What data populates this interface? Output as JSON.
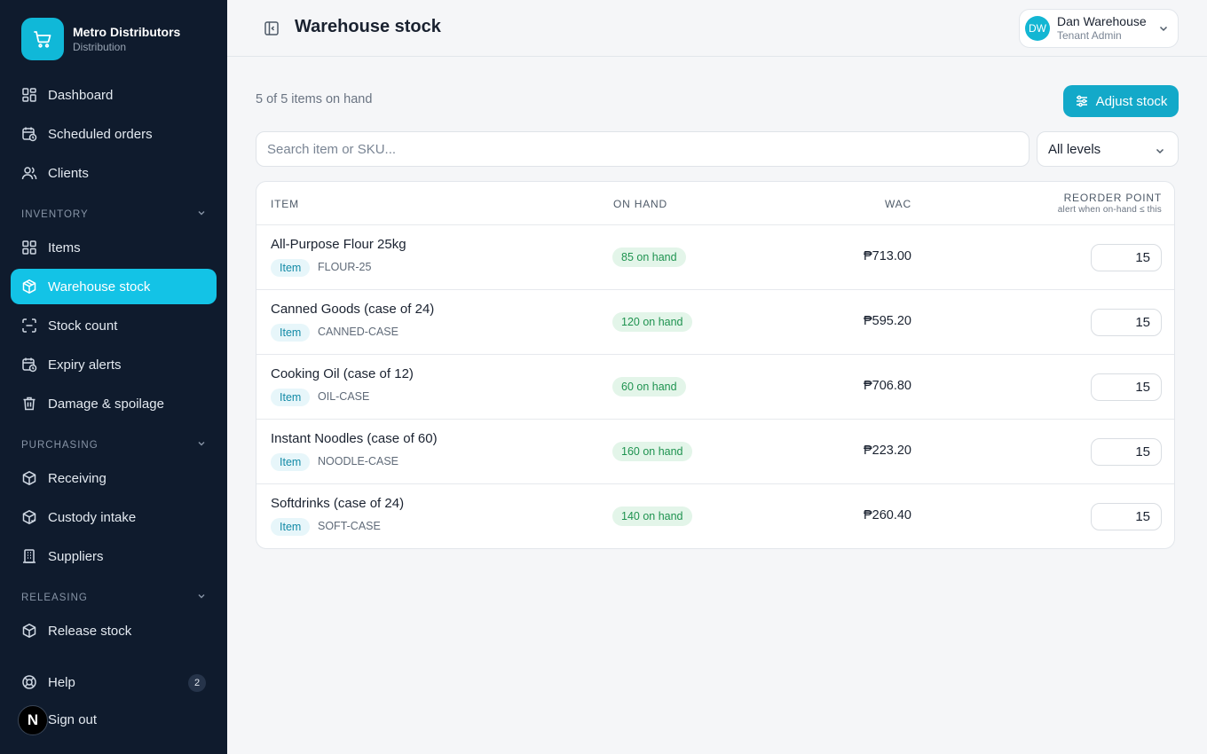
{
  "brand": {
    "name": "Metro Distributors",
    "subtitle": "Distribution",
    "logo_icon": "cart-icon",
    "color": "#10b8d8"
  },
  "sidebar": {
    "top_items": [
      {
        "label": "Dashboard",
        "icon": "dashboard-icon"
      },
      {
        "label": "Scheduled orders",
        "icon": "calendar-clock-icon"
      },
      {
        "label": "Clients",
        "icon": "users-icon"
      }
    ],
    "sections": [
      {
        "label": "INVENTORY",
        "items": [
          {
            "label": "Items",
            "icon": "grid-icon"
          },
          {
            "label": "Warehouse stock",
            "icon": "box-icon",
            "active": true
          },
          {
            "label": "Stock count",
            "icon": "scan-icon"
          },
          {
            "label": "Expiry alerts",
            "icon": "calendar-clock-icon"
          },
          {
            "label": "Damage & spoilage",
            "icon": "trash-icon"
          }
        ]
      },
      {
        "label": "PURCHASING",
        "items": [
          {
            "label": "Receiving",
            "icon": "box-icon"
          },
          {
            "label": "Custody intake",
            "icon": "box-icon"
          },
          {
            "label": "Suppliers",
            "icon": "building-icon"
          }
        ]
      },
      {
        "label": "RELEASING",
        "items": [
          {
            "label": "Release stock",
            "icon": "box-icon"
          }
        ]
      }
    ],
    "help": {
      "label": "Help",
      "badge": "2",
      "icon": "lifebuoy-icon"
    },
    "signout": {
      "label": "Sign out"
    },
    "overlay_badge": "N"
  },
  "header": {
    "title": "Warehouse stock",
    "user": {
      "initials": "DW",
      "name": "Dan Warehouse",
      "role": "Tenant Admin"
    }
  },
  "main": {
    "summary": "5 of 5 items on hand",
    "adjust_label": "Adjust stock",
    "search_placeholder": "Search item or SKU...",
    "level_filter": "All levels",
    "accent_color": "#13a9c9"
  },
  "table": {
    "headers": {
      "item": "ITEM",
      "on_hand": "ON HAND",
      "wac": "WAC",
      "reorder": "REORDER POINT",
      "reorder_sub": "alert when on-hand ≤ this"
    },
    "rows": [
      {
        "name": "All-Purpose Flour 25kg",
        "tag": "Item",
        "sku": "FLOUR-25",
        "on_hand": "85 on hand",
        "wac": "₱713.00",
        "reorder": "15"
      },
      {
        "name": "Canned Goods (case of 24)",
        "tag": "Item",
        "sku": "CANNED-CASE",
        "on_hand": "120 on hand",
        "wac": "₱595.20",
        "reorder": "15"
      },
      {
        "name": "Cooking Oil (case of 12)",
        "tag": "Item",
        "sku": "OIL-CASE",
        "on_hand": "60 on hand",
        "wac": "₱706.80",
        "reorder": "15"
      },
      {
        "name": "Instant Noodles (case of 60)",
        "tag": "Item",
        "sku": "NOODLE-CASE",
        "on_hand": "160 on hand",
        "wac": "₱223.20",
        "reorder": "15"
      },
      {
        "name": "Softdrinks (case of 24)",
        "tag": "Item",
        "sku": "SOFT-CASE",
        "on_hand": "140 on hand",
        "wac": "₱260.40",
        "reorder": "15"
      }
    ]
  }
}
